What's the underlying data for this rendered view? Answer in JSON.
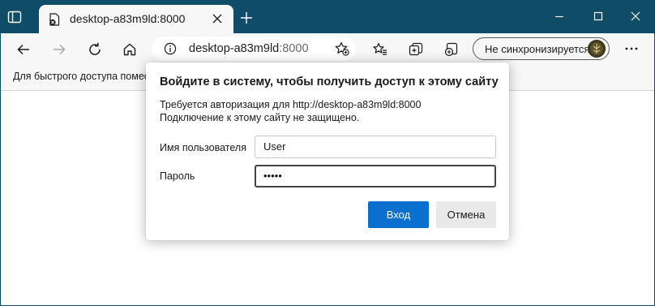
{
  "browser": {
    "tab": {
      "title": "desktop-a83m9ld:8000"
    },
    "address_bar": {
      "host": "desktop-a83m9ld",
      "port": ":8000"
    },
    "sync_status": "Не синхронизируется",
    "favorites_bar_text": "Для быстрого доступа помес",
    "colors": {
      "titlebar": "#0f4c68",
      "toolbar": "#f7f7f7"
    }
  },
  "auth_dialog": {
    "title": "Войдите в систему, чтобы получить доступ к этому сайту",
    "description_line1": "Требуется авторизация для http://desktop-a83m9ld:8000",
    "description_line2": "Подключение к этому сайту не защищено.",
    "username_label": "Имя пользователя",
    "username_value": "User",
    "password_label": "Пароль",
    "password_value": "•••••",
    "login_button": "Вход",
    "cancel_button": "Отмена",
    "colors": {
      "primary": "#0a6fcf",
      "secondary": "#e9e9e9"
    }
  }
}
